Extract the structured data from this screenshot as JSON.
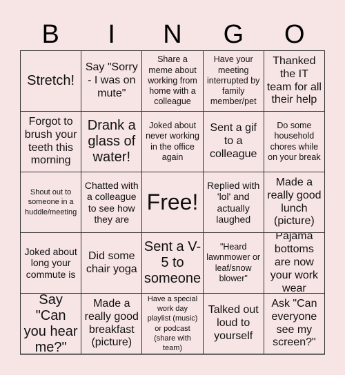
{
  "header": {
    "letters": [
      "B",
      "I",
      "N",
      "G",
      "O"
    ]
  },
  "board": {
    "rows": [
      [
        "Stretch!",
        "Say \"Sorry - I was on mute\"",
        "Share a meme about working from home with a colleague",
        "Have your meeting interrupted by family member/pet",
        "Thanked the IT team for all their help"
      ],
      [
        "Forgot to brush your teeth this morning",
        "Drank a glass of water!",
        "Joked about never working in the office again",
        "Sent a gif to a colleague",
        "Do some household chores while on your break"
      ],
      [
        "Shout out to someone in a huddle/meeting",
        "Chatted with a colleague to see how they are",
        "Free!",
        "Replied with 'lol' and actually laughed",
        "Made a really good lunch (picture)"
      ],
      [
        "Joked about long your commute is",
        "Did some chair yoga",
        "Sent a V-5 to someone",
        "\"Heard lawnmower or leaf/snow blower\"",
        "Pajama bottoms are now your work wear"
      ],
      [
        "Say \"Can you hear me?\"",
        "Made a really good breakfast (picture)",
        "Have a special work day playlist (music) or podcast (share with team)",
        "Talked out loud to yourself",
        "Ask \"Can everyone see my screen?\""
      ]
    ]
  },
  "colors": {
    "background": "#f7e4e5",
    "grid_line": "#333333",
    "text": "#111111"
  }
}
